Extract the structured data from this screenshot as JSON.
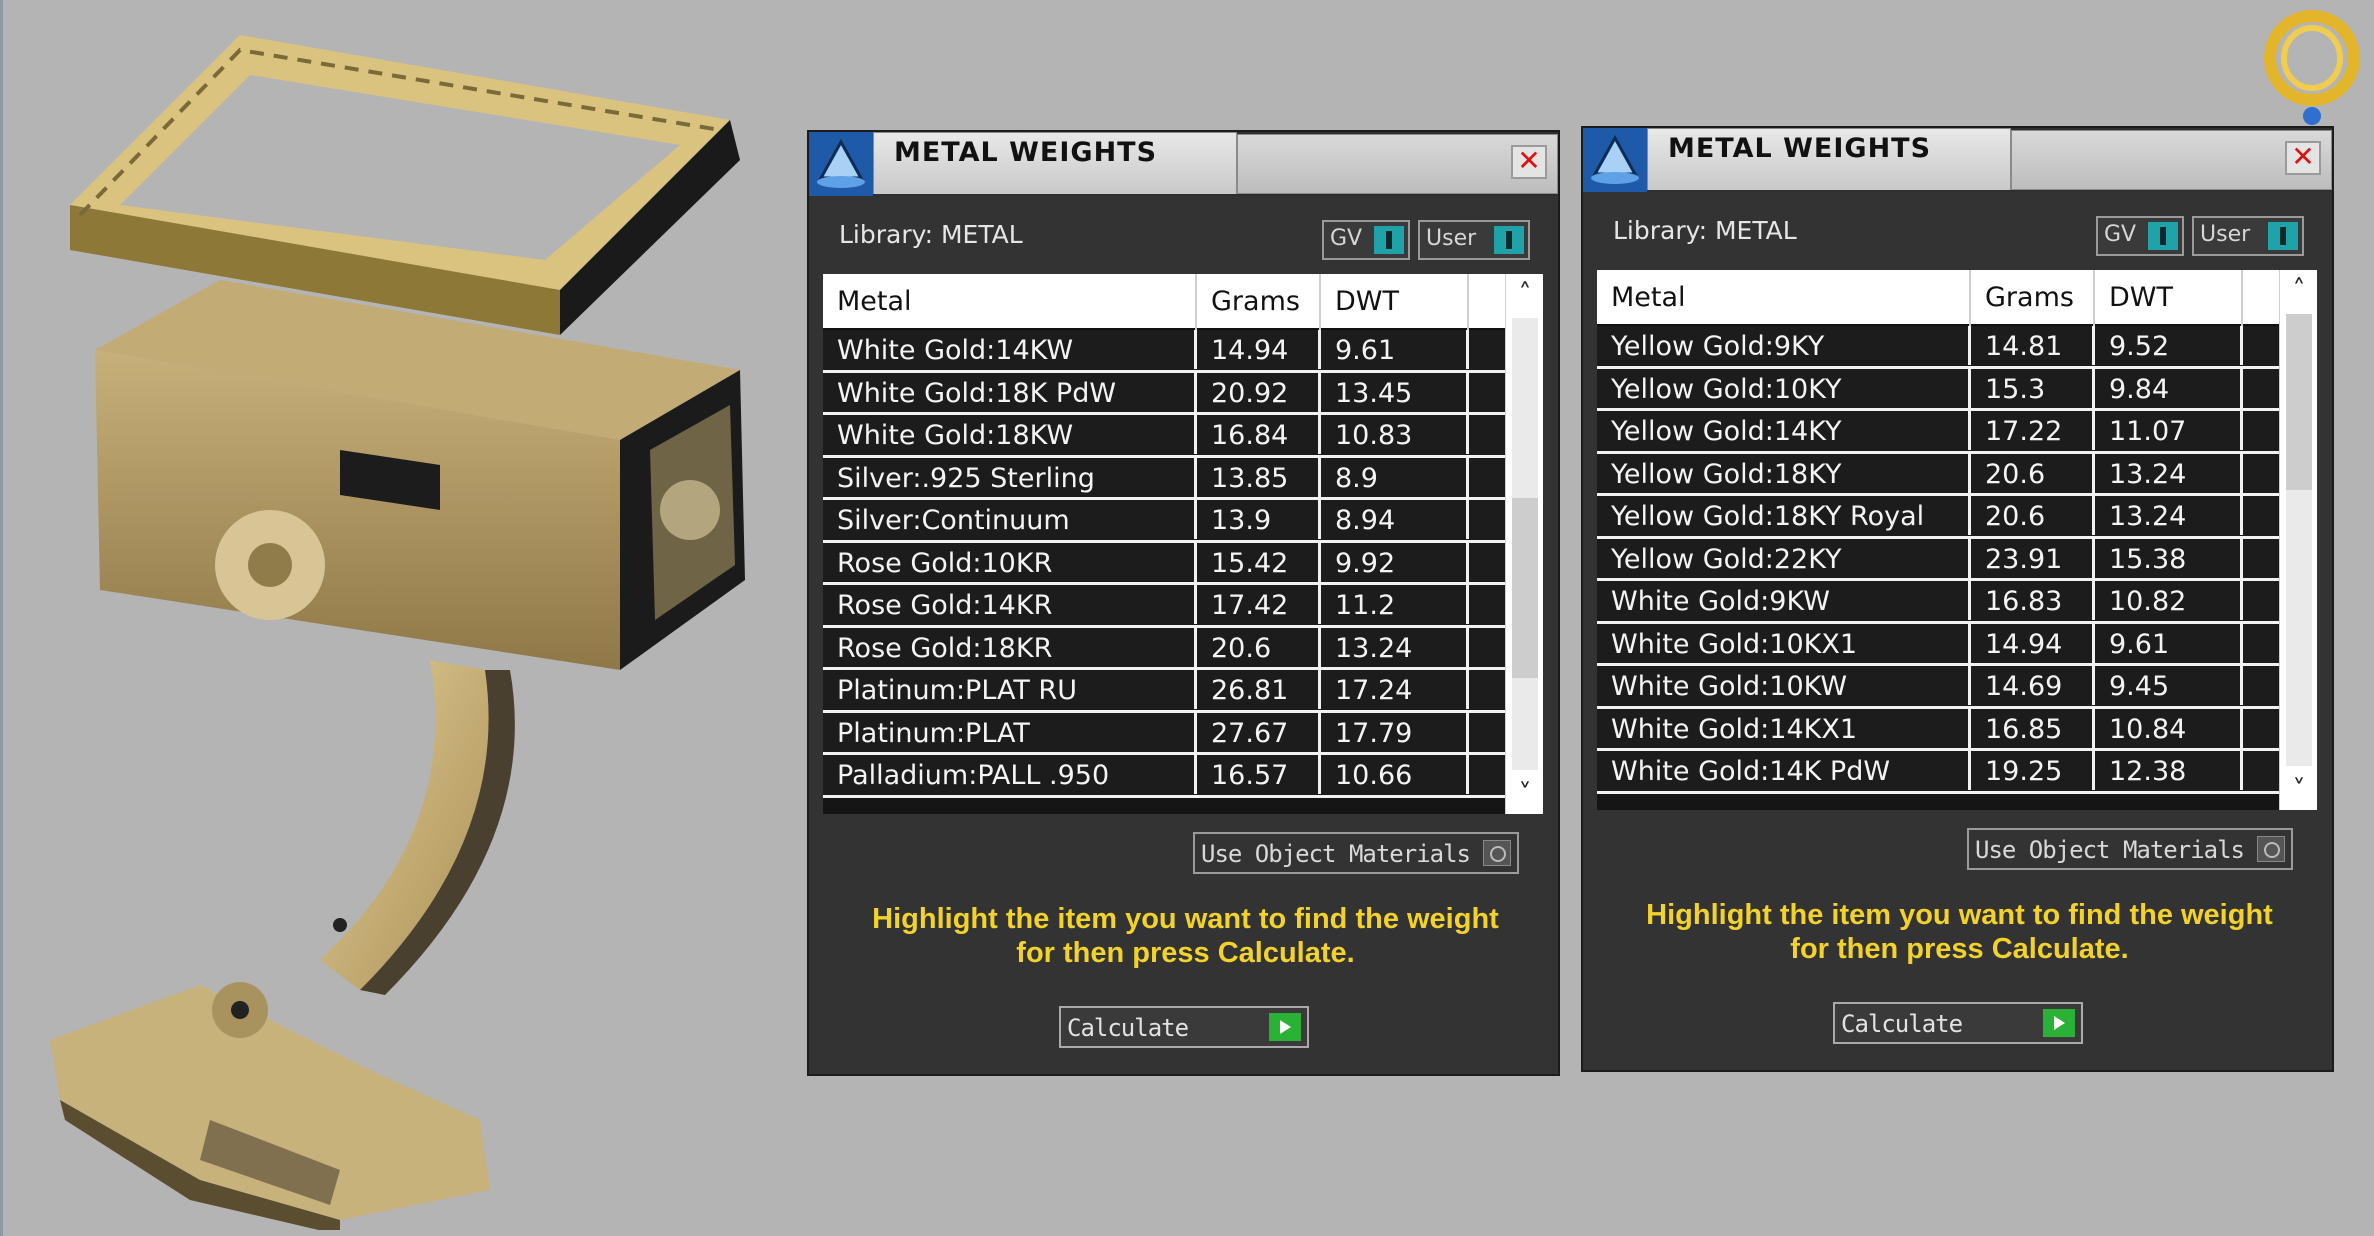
{
  "panels": [
    {
      "title": "METAL WEIGHTS",
      "close_symbol": "✕",
      "library_label": "Library: METAL",
      "toggle_gv": "GV",
      "toggle_user": "User",
      "columns": {
        "metal": "Metal",
        "grams": "Grams",
        "dwt": "DWT"
      },
      "rows": [
        {
          "metal": "White Gold:14KW",
          "grams": "14.94",
          "dwt": "9.61"
        },
        {
          "metal": "White Gold:18K PdW",
          "grams": "20.92",
          "dwt": "13.45"
        },
        {
          "metal": "White Gold:18KW",
          "grams": "16.84",
          "dwt": "10.83"
        },
        {
          "metal": "Silver:.925 Sterling",
          "grams": "13.85",
          "dwt": "8.9"
        },
        {
          "metal": "Silver:Continuum",
          "grams": "13.9",
          "dwt": "8.94"
        },
        {
          "metal": "Rose Gold:10KR",
          "grams": "15.42",
          "dwt": "9.92"
        },
        {
          "metal": "Rose Gold:14KR",
          "grams": "17.42",
          "dwt": "11.2"
        },
        {
          "metal": "Rose Gold:18KR",
          "grams": "20.6",
          "dwt": "13.24"
        },
        {
          "metal": "Platinum:PLAT RU",
          "grams": "26.81",
          "dwt": "17.24"
        },
        {
          "metal": "Platinum:PLAT",
          "grams": "27.67",
          "dwt": "17.79"
        },
        {
          "metal": "Palladium:PALL .950",
          "grams": "16.57",
          "dwt": "10.66"
        }
      ],
      "scroll_up": "˄",
      "scroll_down": "˅",
      "use_object_materials": "Use Object Materials",
      "instruction_line1": "Highlight the item you want to find the weight",
      "instruction_line2": "for then press Calculate.",
      "calculate_label": "Calculate"
    },
    {
      "title": "METAL WEIGHTS",
      "close_symbol": "✕",
      "library_label": "Library: METAL",
      "toggle_gv": "GV",
      "toggle_user": "User",
      "columns": {
        "metal": "Metal",
        "grams": "Grams",
        "dwt": "DWT"
      },
      "rows": [
        {
          "metal": "Yellow Gold:9KY",
          "grams": "14.81",
          "dwt": "9.52"
        },
        {
          "metal": "Yellow Gold:10KY",
          "grams": "15.3",
          "dwt": "9.84"
        },
        {
          "metal": "Yellow Gold:14KY",
          "grams": "17.22",
          "dwt": "11.07"
        },
        {
          "metal": "Yellow Gold:18KY",
          "grams": "20.6",
          "dwt": "13.24"
        },
        {
          "metal": "Yellow Gold:18KY Royal",
          "grams": "20.6",
          "dwt": "13.24"
        },
        {
          "metal": "Yellow Gold:22KY",
          "grams": "23.91",
          "dwt": "15.38"
        },
        {
          "metal": "White Gold:9KW",
          "grams": "16.83",
          "dwt": "10.82"
        },
        {
          "metal": "White Gold:10KX1",
          "grams": "14.94",
          "dwt": "9.61"
        },
        {
          "metal": "White Gold:10KW",
          "grams": "14.69",
          "dwt": "9.45"
        },
        {
          "metal": "White Gold:14KX1",
          "grams": "16.85",
          "dwt": "10.84"
        },
        {
          "metal": "White Gold:14K PdW",
          "grams": "19.25",
          "dwt": "12.38"
        }
      ],
      "scroll_up": "˄",
      "scroll_down": "˅",
      "use_object_materials": "Use Object Materials",
      "instruction_line1": "Highlight the item you want to find the weight",
      "instruction_line2": "for then press Calculate.",
      "calculate_label": "Calculate"
    }
  ],
  "colors": {
    "viewport_bg": "#b4b4b4",
    "panel_bg": "#333333",
    "instruction_text": "#f2d22b",
    "toggle_knob": "#1fa3a8",
    "calculate_play": "#29b236",
    "model_gold": "#c8b07a"
  }
}
